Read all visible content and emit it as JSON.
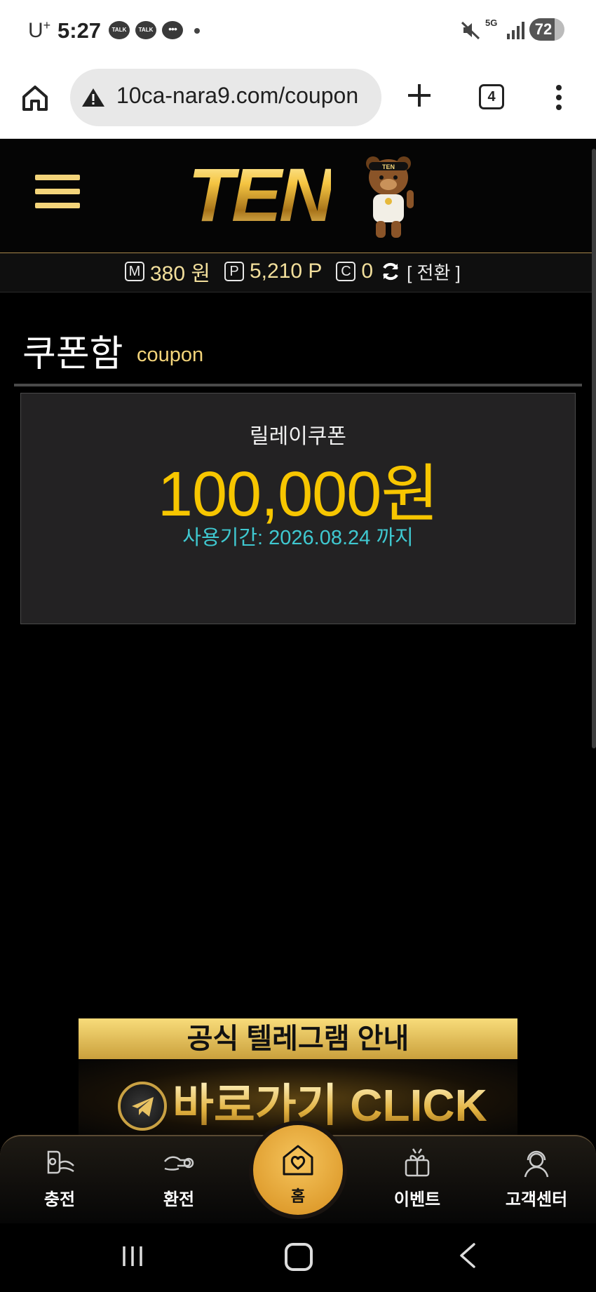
{
  "status_bar": {
    "carrier": "U",
    "carrier_sup": "+",
    "time": "5:27",
    "notification_label": "TALK",
    "network": "5G",
    "battery": "72",
    "battery_level": 0.72
  },
  "browser": {
    "url": "10ca-nara9.com/coupon",
    "tab_count": "4",
    "icons": [
      "home-icon",
      "warning-icon",
      "plus-icon",
      "tabs-icon",
      "more-vert-icon"
    ]
  },
  "header": {
    "logo_text": "TEN",
    "logo_badge": "TEN"
  },
  "balance": {
    "money_icon": "M",
    "money_value": "380 원",
    "point_icon": "P",
    "point_value": "5,210 P",
    "casino_icon": "C",
    "casino_value": "0",
    "switch_label": "[ 전환 ]"
  },
  "page": {
    "title": "쿠폰함",
    "subtitle": "coupon"
  },
  "coupon": {
    "name": "릴레이쿠폰",
    "amount": "100,000원",
    "expiry": "사용기간: 2026.08.24 까지"
  },
  "banner": {
    "title": "공식 텔레그램 안내",
    "cta": "바로가기 CLICK"
  },
  "bottom_nav": {
    "items": [
      {
        "label": "충전",
        "icon": "deposit-icon"
      },
      {
        "label": "환전",
        "icon": "withdraw-icon"
      },
      {
        "label": "홈",
        "icon": "home-heart-icon"
      },
      {
        "label": "이벤트",
        "icon": "gift-icon"
      },
      {
        "label": "고객센터",
        "icon": "support-icon"
      }
    ]
  },
  "colors": {
    "accent_gold": "#f7c600",
    "expiry_cyan": "#3fc8d0",
    "menu_gold": "#f3d47a"
  }
}
